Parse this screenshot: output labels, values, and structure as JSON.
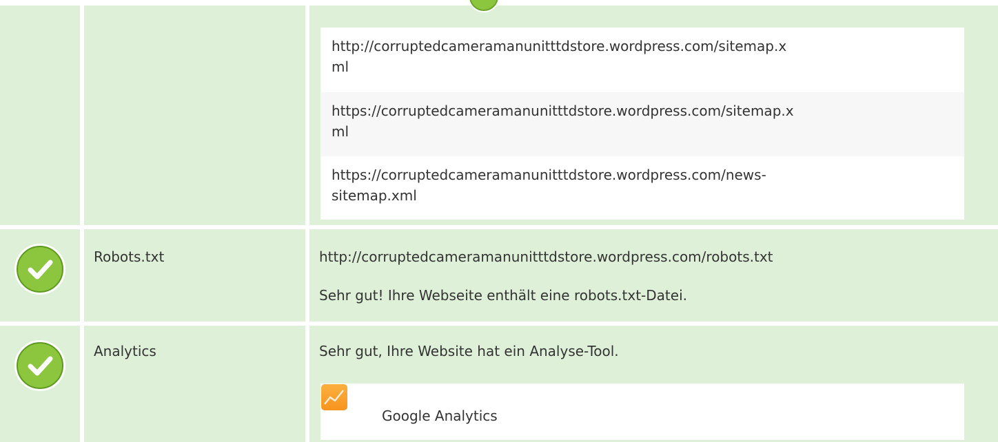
{
  "sitemaps": {
    "items": [
      {
        "line1": "http://corruptedcameramanunitttdstore.wordpress.com/sitemap.x",
        "line2": "ml"
      },
      {
        "line1": "https://corruptedcameramanunitttdstore.wordpress.com/sitemap.x",
        "line2": "ml"
      },
      {
        "line1": "https://corruptedcameramanunitttdstore.wordpress.com/news-",
        "line2": "sitemap.xml"
      }
    ]
  },
  "robots": {
    "label": "Robots.txt",
    "url": "http://corruptedcameramanunitttdstore.wordpress.com/robots.txt",
    "message": "Sehr gut! Ihre Webseite enthält eine robots.txt-Datei.",
    "status_icon": "check-circle-icon"
  },
  "analytics": {
    "label": "Analytics",
    "message": "Sehr gut, Ihre Website hat ein Analyse-Tool.",
    "tool_name": "Google Analytics",
    "tool_icon": "google-analytics-icon",
    "status_icon": "check-circle-icon"
  },
  "colors": {
    "row_background": "#dff0d8",
    "check_green": "#8cc63f",
    "check_dark": "#5d9a1e",
    "analytics_orange": "#f9a03f"
  }
}
